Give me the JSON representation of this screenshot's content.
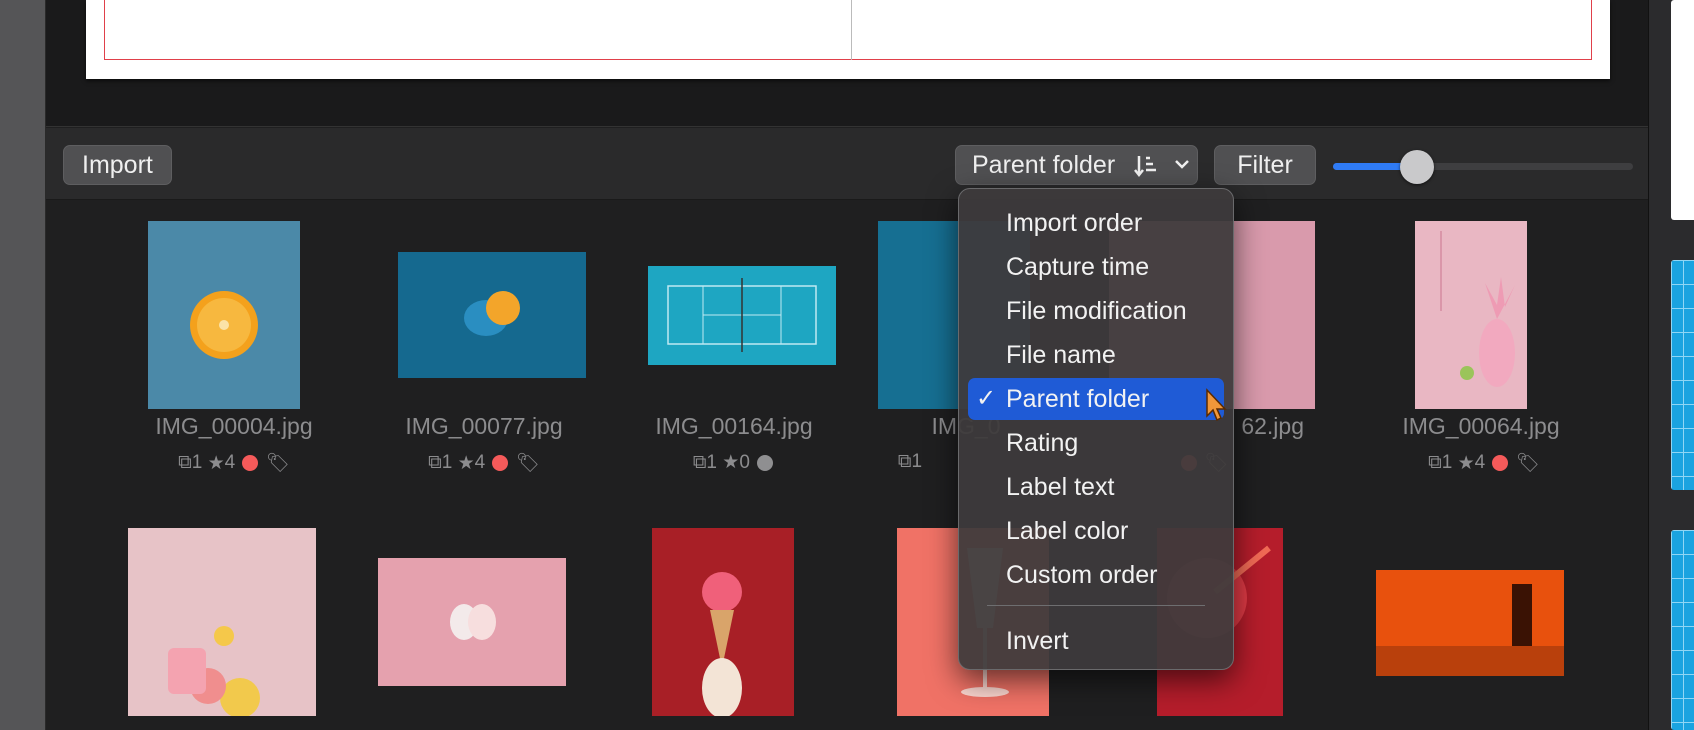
{
  "toolbar": {
    "import_label": "Import",
    "sort_label": "Parent folder",
    "sort_icon": "sort-order-icon",
    "filter_label": "Filter",
    "zoom_slider_value": 0.28
  },
  "photos": [
    {
      "filename": "IMG_00004.jpg",
      "versions": "1",
      "rating": "4",
      "label_color": "#f55a5a",
      "tagged": true
    },
    {
      "filename": "IMG_00077.jpg",
      "versions": "1",
      "rating": "4",
      "label_color": "#f55a5a",
      "tagged": true
    },
    {
      "filename": "IMG_00164.jpg",
      "versions": "1",
      "rating": "0",
      "label_color": "#8f8f91",
      "tagged": false
    },
    {
      "filename": "IMG_0",
      "versions": "1",
      "rating": "",
      "label_color": "",
      "tagged": false
    },
    {
      "filename": "62.jpg",
      "versions": "",
      "rating": "",
      "label_color": "#f55a5a",
      "tagged": true
    },
    {
      "filename": "IMG_00064.jpg",
      "versions": "1",
      "rating": "4",
      "label_color": "#f55a5a",
      "tagged": true
    }
  ],
  "sort_menu": {
    "items": [
      {
        "label": "Import order",
        "selected": false
      },
      {
        "label": "Capture time",
        "selected": false
      },
      {
        "label": "File modification",
        "selected": false
      },
      {
        "label": "File name",
        "selected": false
      },
      {
        "label": "Parent folder",
        "selected": true
      },
      {
        "label": "Rating",
        "selected": false
      },
      {
        "label": "Label text",
        "selected": false
      },
      {
        "label": "Label color",
        "selected": false
      },
      {
        "label": "Custom order",
        "selected": false
      }
    ],
    "invert_label": "Invert",
    "check_mark": "✓"
  },
  "colors": {
    "accent": "#1f5bd6",
    "slider_fill": "#2f7bf5",
    "label_red": "#f55a5a"
  }
}
